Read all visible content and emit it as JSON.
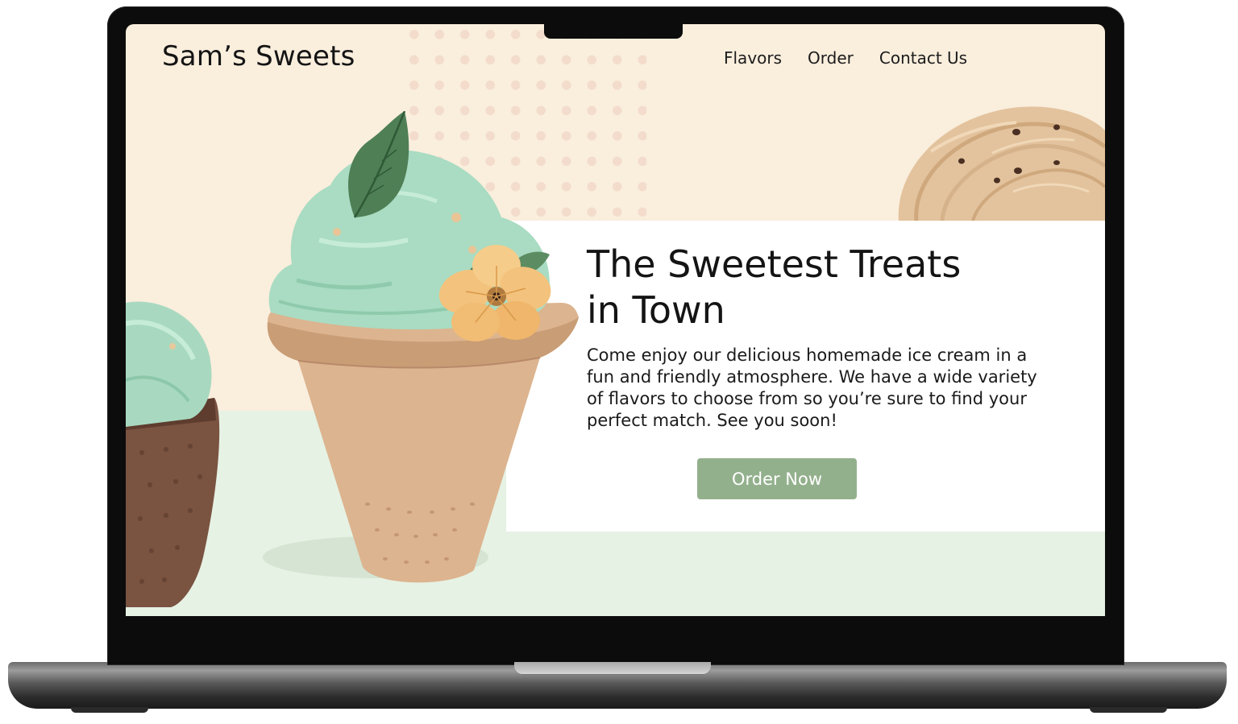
{
  "header": {
    "logo_text": "Sam’s Sweets",
    "nav": [
      {
        "label": "Flavors"
      },
      {
        "label": "Order"
      },
      {
        "label": "Contact Us"
      }
    ]
  },
  "hero": {
    "title_line1": "The Sweetest Treats",
    "title_line2": "in Town",
    "body": "Come enjoy our delicious homemade ice cream in a fun and friendly atmosphere. We have a wide variety of flavors to choose from so you’re sure to find your perfect match. See you soon!",
    "cta_label": "Order Now"
  },
  "colors": {
    "page_cream": "#faeedd",
    "mint_floor": "#e6f2e4",
    "polka_dot": "#f3dccb",
    "button_green": "#93b08c",
    "text_dark": "#141414"
  },
  "images": {
    "main_cone": "mint ice cream cone with leaf and dried orange flower",
    "left_cone": "mint ice cream in chocolate cone",
    "top_right_scoop": "vanilla chocolate-chip scoop"
  }
}
